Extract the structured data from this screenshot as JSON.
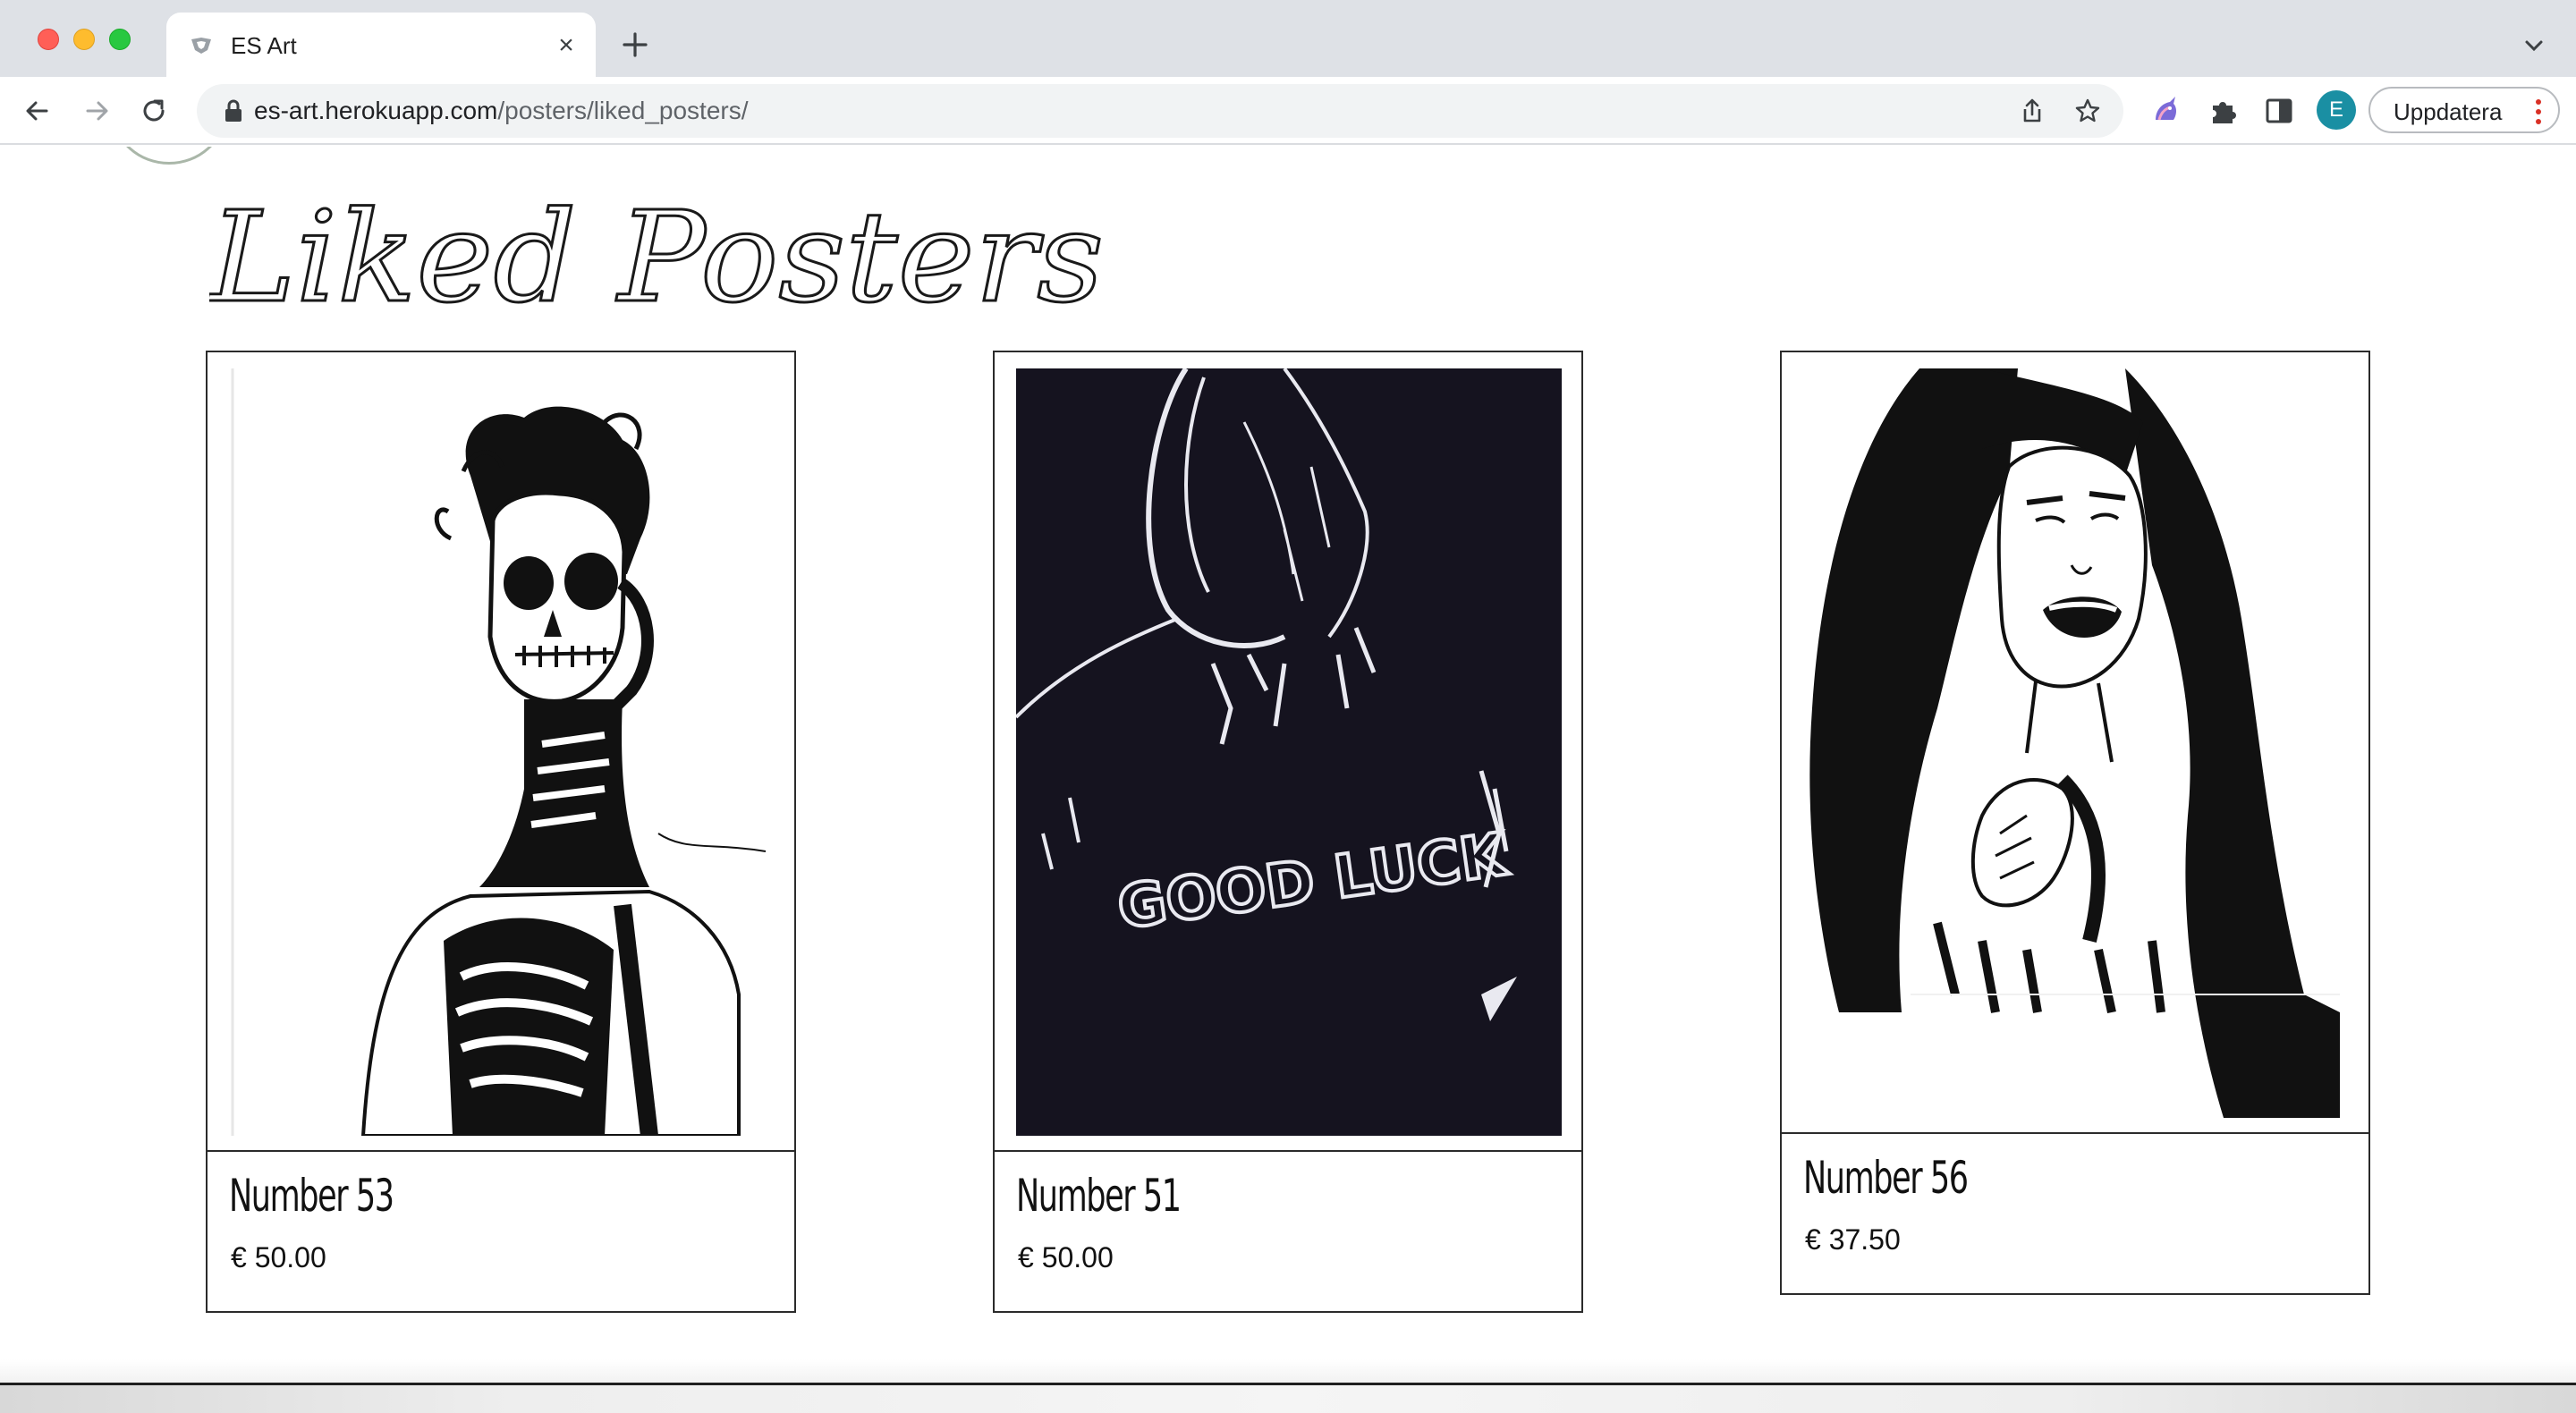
{
  "browser": {
    "tab_title": "ES Art",
    "url_host": "es-art.herokuapp.com",
    "url_path": "/posters/liked_posters/",
    "profile_initial": "E",
    "update_label": "Uppdatera"
  },
  "page": {
    "title": "Liked Posters"
  },
  "posters": [
    {
      "name": "Number 53",
      "price": "€ 50.00"
    },
    {
      "name": "Number 51",
      "price": "€ 50.00",
      "artwork_text": "GOOD LUCK"
    },
    {
      "name": "Number 56",
      "price": "€ 37.50"
    }
  ],
  "colors": {
    "tabstrip": "#dee1e6",
    "card_border": "#2b2b2b",
    "ink": "#111111",
    "avatar": "#1a8fa3"
  }
}
